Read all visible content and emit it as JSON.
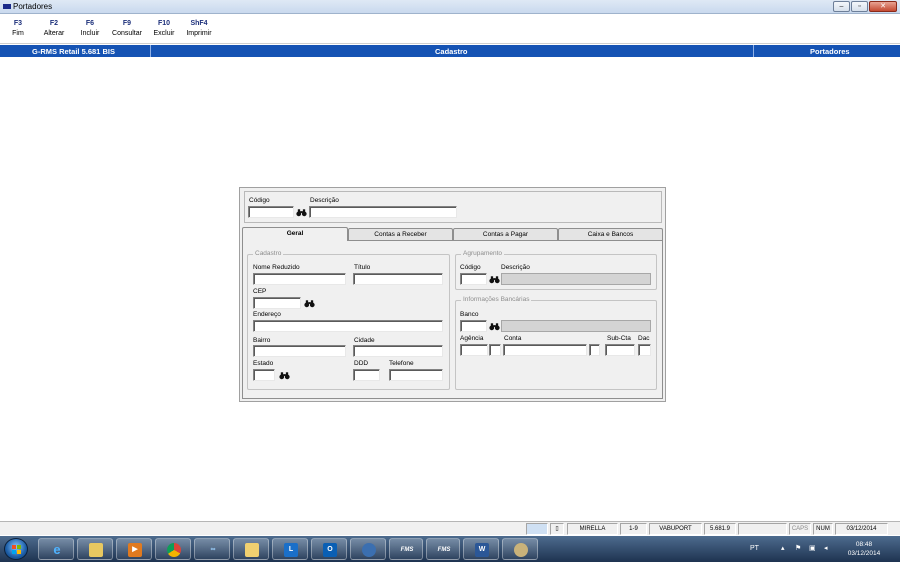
{
  "window": {
    "title": "Portadores"
  },
  "fkeys": [
    {
      "key": "F3",
      "label": "Fim"
    },
    {
      "key": "F2",
      "label": "Alterar"
    },
    {
      "key": "F6",
      "label": "Incluir"
    },
    {
      "key": "F9",
      "label": "Consultar"
    },
    {
      "key": "F10",
      "label": "Excluir"
    },
    {
      "key": "ShF4",
      "label": "Imprimir"
    }
  ],
  "header": {
    "product": "G-RMS Retail 5.681 BIS",
    "section": "Cadastro",
    "module": "Portadores"
  },
  "form": {
    "codigo_label": "Código",
    "descricao_label": "Descrição",
    "tabs": [
      "Geral",
      "Contas a Receber",
      "Contas a Pagar",
      "Caixa e Bancos"
    ],
    "cadastro": {
      "title": "Cadastro",
      "nome_reduzido": "Nome Reduzido",
      "titulo": "Título",
      "cep": "CEP",
      "endereco": "Endereço",
      "bairro": "Bairro",
      "cidade": "Cidade",
      "estado": "Estado",
      "ddd": "DDD",
      "telefone": "Telefone"
    },
    "agrupamento": {
      "title": "Agrupamento",
      "codigo": "Código",
      "descricao": "Descrição"
    },
    "bancarias": {
      "title": "Informações Bancárias",
      "banco": "Banco",
      "agencia": "Agência",
      "conta": "Conta",
      "subcta": "Sub-Cta",
      "dac": "Dac"
    }
  },
  "statusbar": {
    "user": "MIRELLA",
    "range": "1-9",
    "program": "VABUPORT",
    "version": "5.681.9",
    "caps": "CAPS",
    "num": "NUM",
    "date": "03/12/2014"
  },
  "taskbar": {
    "apps": [
      "internet-explorer",
      "file-explorer",
      "media-player",
      "chrome",
      "app",
      "folder",
      "lync",
      "outlook",
      "app",
      "fms",
      "fms",
      "word",
      "app"
    ],
    "fms_label": "FMS",
    "lang": "PT",
    "time": "08:48",
    "date": "03/12/2014"
  }
}
